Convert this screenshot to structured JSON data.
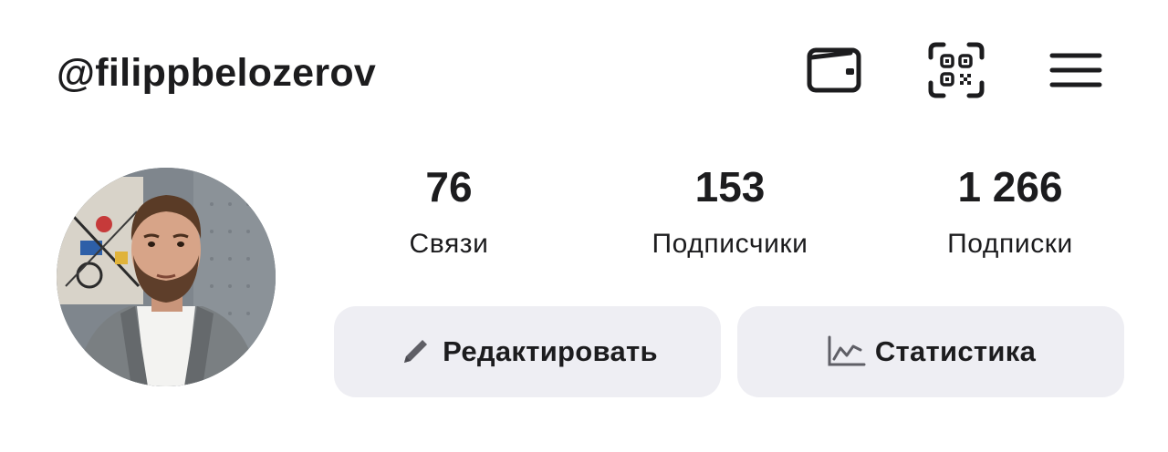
{
  "profile": {
    "username": "@filippbelozerov"
  },
  "header": {
    "icons": [
      "wallet-icon",
      "qr-code-icon",
      "menu-icon"
    ]
  },
  "stats": [
    {
      "value": "76",
      "label": "Связи"
    },
    {
      "value": "153",
      "label": "Подписчики"
    },
    {
      "value": "1 266",
      "label": "Подписки"
    }
  ],
  "actions": {
    "edit_label": "Редактировать",
    "stats_label": "Статистика",
    "edit_icon": "pencil-icon",
    "stats_icon": "chart-icon"
  },
  "colors": {
    "text": "#1c1c1e",
    "button_bg": "#eeeef3",
    "icon_gray": "#5f5f66",
    "background": "#ffffff"
  }
}
